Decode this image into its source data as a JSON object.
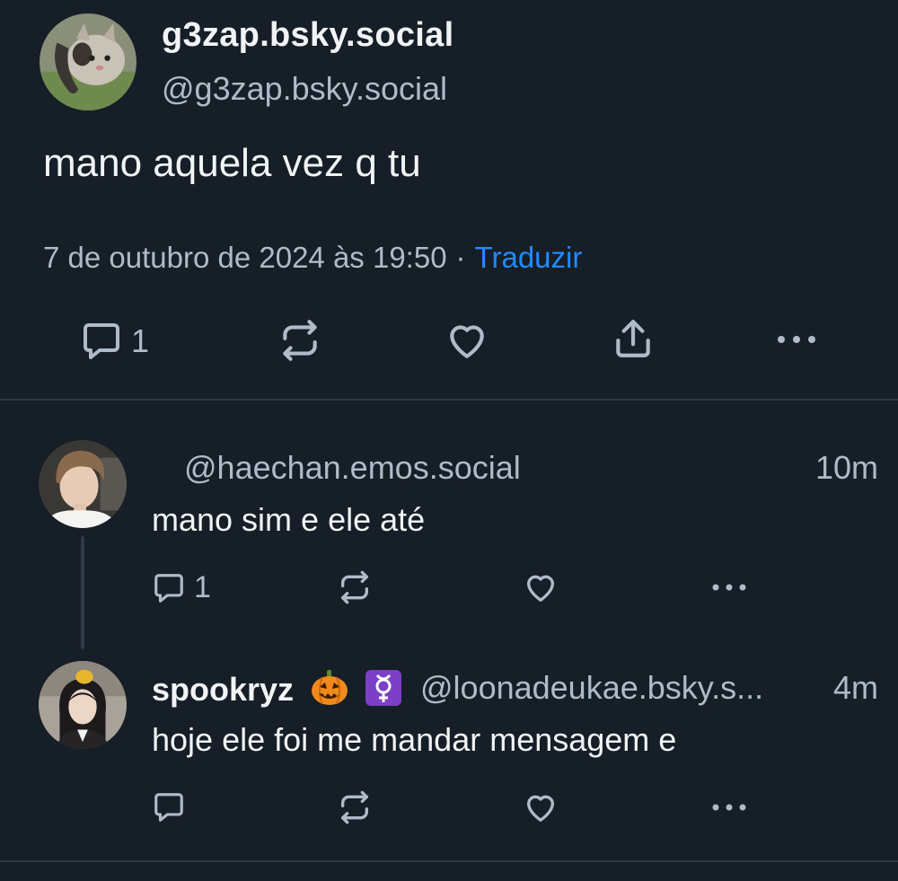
{
  "post": {
    "display_name": "g3zap.bsky.social",
    "handle": "@g3zap.bsky.social",
    "text": "mano aquela vez q tu",
    "timestamp": "7 de outubro de 2024 às 19:50",
    "separator": "·",
    "translate_label": "Traduzir",
    "reply_count": "1"
  },
  "replies": [
    {
      "handle": "@haechan.emos.social",
      "time": "10m",
      "text": "mano sim e ele até",
      "reply_count": "1"
    },
    {
      "display_name": "spookryz",
      "handle": "@loonadeukae.bsky.s...",
      "time": "4m",
      "text": "hoje ele foi me mandar mensagem e",
      "reply_count": ""
    }
  ],
  "icons": {
    "reply": "speech-bubble-icon",
    "repost": "repost-icon",
    "like": "heart-icon",
    "share": "share-icon",
    "more": "more-icon"
  },
  "colors": {
    "background": "#161e27",
    "text": "#f1f3f5",
    "muted": "#aebbc9",
    "link": "#208bfe",
    "divider": "#2e3a48"
  }
}
